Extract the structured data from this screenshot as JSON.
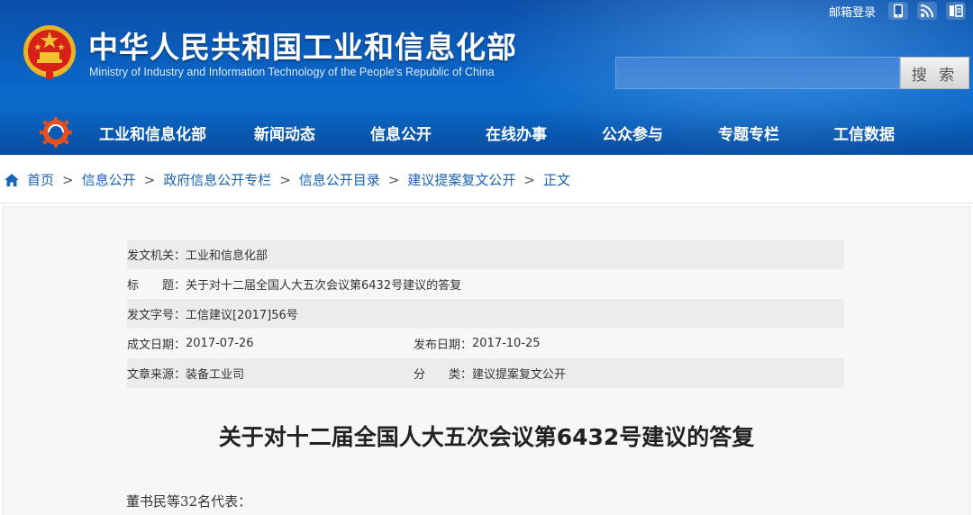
{
  "header": {
    "site_title": "中华人民共和国工业和信息化部",
    "site_subtitle": "Ministry of Industry and Information Technology of the People's Republic of China",
    "mail_link": "邮箱登录",
    "icons": [
      "mobile-icon",
      "rss-icon",
      "weibo-icon"
    ],
    "search_placeholder": "",
    "search_button": "搜 索"
  },
  "nav": {
    "items": [
      "工业和信息化部",
      "新闻动态",
      "信息公开",
      "在线办事",
      "公众参与",
      "专题专栏",
      "工信数据"
    ]
  },
  "breadcrumb": {
    "items": [
      "首页",
      "信息公开",
      "政府信息公开专栏",
      "信息公开目录",
      "建议提案复文公开",
      "正文"
    ],
    "separator": ">"
  },
  "meta": {
    "issuer_label": "发文机关：",
    "issuer": "工业和信息化部",
    "title_label": "标　　题：",
    "title": "关于对十二届全国人大五次会议第6432号建议的答复",
    "doc_no_label": "发文字号：",
    "doc_no": "工信建议[2017]56号",
    "written_date_label": "成文日期：",
    "written_date": "2017-07-26",
    "publish_date_label": "发布日期：",
    "publish_date": "2017-10-25",
    "source_label": "文章来源：",
    "source": "装备工业司",
    "category_label": "分　　类：",
    "category": "建议提案复文公开"
  },
  "article": {
    "title": "关于对十二届全国人大五次会议第6432号建议的答复",
    "greeting": "董书民等32名代表："
  },
  "colors": {
    "header_blue": "#0a62c2",
    "link_blue": "#1a63b5",
    "emblem_red": "#d62018",
    "emblem_gold": "#f2c230"
  }
}
